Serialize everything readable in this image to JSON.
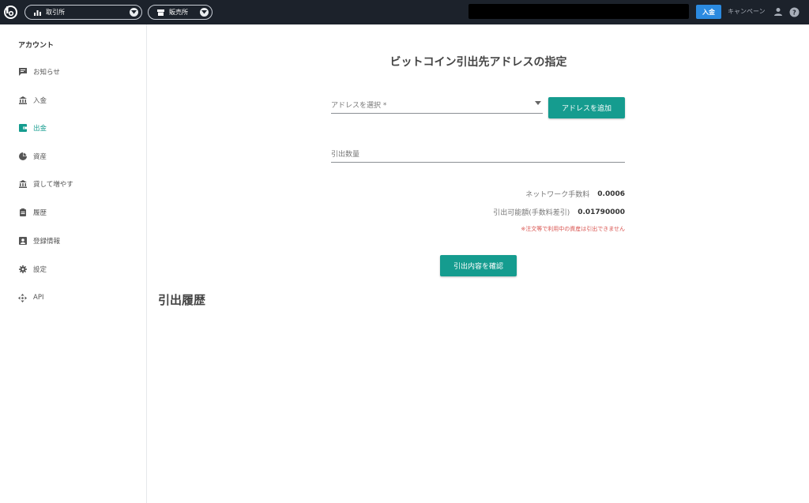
{
  "topbar": {
    "exchange_label": "取引所",
    "sales_label": "販売所",
    "deposit_label": "入金",
    "campaign_label": "キャンペーン",
    "colors": {
      "background": "#1c222b",
      "deposit": "#2b8ae0"
    }
  },
  "sidebar": {
    "heading": "アカウント",
    "items": [
      {
        "label": "お知らせ",
        "icon": "message-icon"
      },
      {
        "label": "入金",
        "icon": "bank-icon"
      },
      {
        "label": "出金",
        "icon": "wallet-icon",
        "active": true
      },
      {
        "label": "資産",
        "icon": "pie-chart-icon"
      },
      {
        "label": "貸して増やす",
        "icon": "bank-icon"
      },
      {
        "label": "履歴",
        "icon": "clipboard-icon"
      },
      {
        "label": "登録情報",
        "icon": "id-card-icon"
      },
      {
        "label": "設定",
        "icon": "gear-icon"
      },
      {
        "label": "API",
        "icon": "move-arrows-icon"
      }
    ],
    "active_color": "#159c8f"
  },
  "main": {
    "title": "ビットコイン引出先アドレスの指定",
    "address_select_placeholder": "アドレスを選択 *",
    "add_address_label": "アドレスを追加",
    "amount_placeholder": "引出数量",
    "network_fee_label": "ネットワーク手数料",
    "network_fee_value": "0.0006",
    "available_label": "引出可能額(手数料差引)",
    "available_value": "0.01790000",
    "note": "※注文等で利用中の資産は引出できません",
    "confirm_label": "引出内容を確認",
    "history_title": "引出履歴",
    "accent_color": "#159c8f"
  }
}
